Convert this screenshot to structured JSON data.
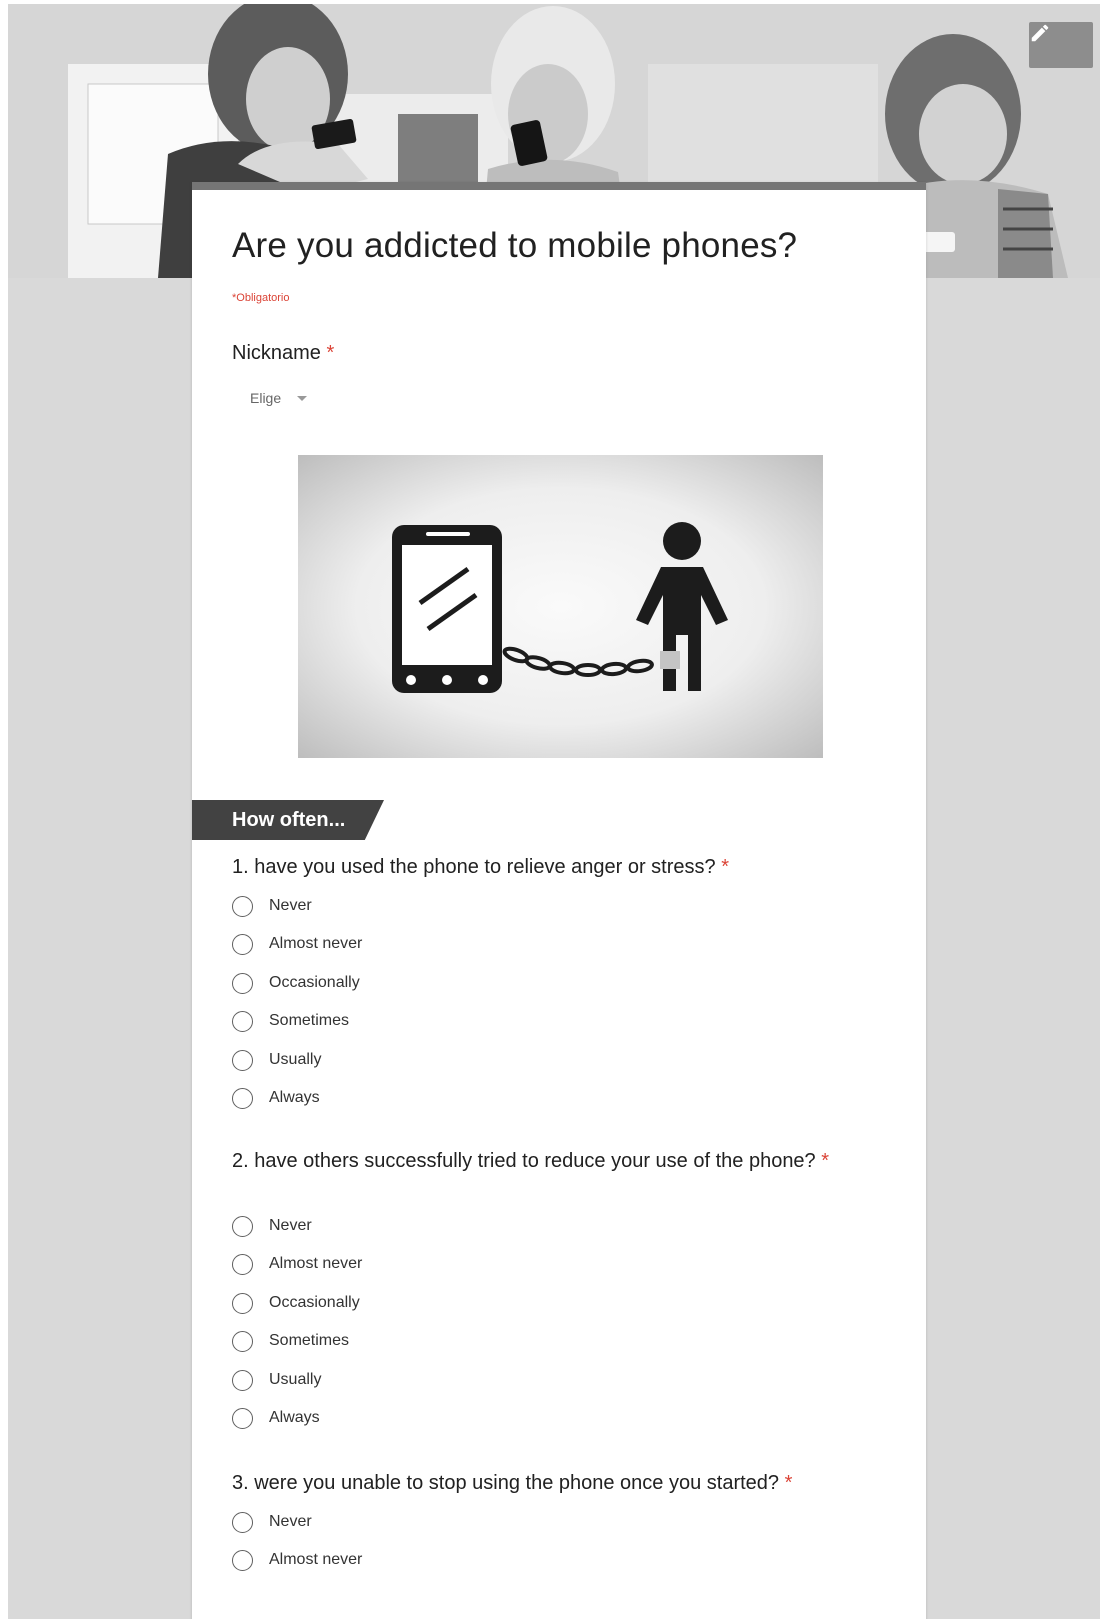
{
  "form": {
    "title": "Are you addicted to mobile phones?",
    "required_note": "*Obligatorio",
    "required_marker": "*"
  },
  "nickname": {
    "label": "Nickname",
    "dropdown_value": "Elige"
  },
  "header": {
    "edit_icon": "pencil-icon"
  },
  "figure": {
    "icon": "phone-chained-to-person-illustration"
  },
  "section": {
    "title": "How often..."
  },
  "questions": [
    {
      "label": "1. have you used the phone to relieve anger or stress?",
      "options": [
        "Never",
        "Almost never",
        "Occasionally",
        "Sometimes",
        "Usually",
        "Always"
      ]
    },
    {
      "label": "2. have others successfully tried to reduce your use of the phone?",
      "options": [
        "Never",
        "Almost never",
        "Occasionally",
        "Sometimes",
        "Usually",
        "Always"
      ]
    },
    {
      "label": "3. were you unable to stop using the phone once you started?",
      "options": [
        "Never",
        "Almost never"
      ]
    }
  ],
  "colors": {
    "required": "#db4437",
    "section_banner": "#424242",
    "card_top_border": "#757575",
    "page_background": "#d9d9d9"
  }
}
